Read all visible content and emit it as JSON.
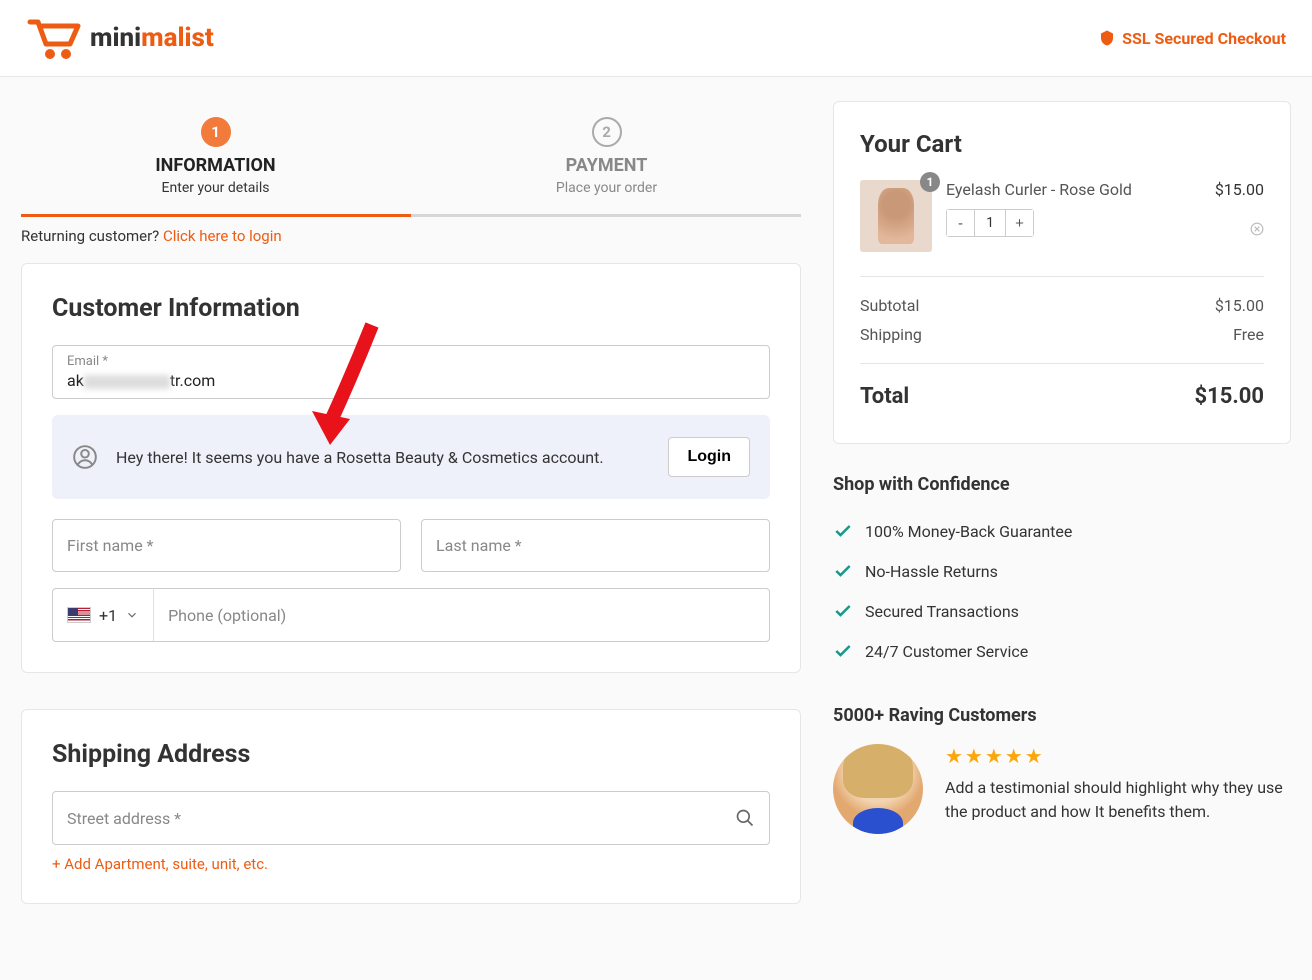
{
  "header": {
    "logo_part1": "mini",
    "logo_part2": "malist",
    "ssl_text": "SSL Secured Checkout"
  },
  "steps": {
    "step1_num": "1",
    "step1_title": "INFORMATION",
    "step1_sub": "Enter your details",
    "step2_num": "2",
    "step2_title": "PAYMENT",
    "step2_sub": "Place your order"
  },
  "returning": {
    "prefix": "Returning customer? ",
    "link": "Click here to login"
  },
  "customer": {
    "heading": "Customer Information",
    "email_label": "Email *",
    "email_prefix": "ak",
    "email_suffix": "tr.com",
    "notice": "Hey there! It seems you have a Rosetta Beauty & Cosmetics account.",
    "login_btn": "Login",
    "first_name_ph": "First name *",
    "last_name_ph": "Last name *",
    "dial": "+1",
    "phone_ph": "Phone (optional)"
  },
  "shipping": {
    "heading": "Shipping Address",
    "street_ph": "Street address *",
    "add_apt": "Add Apartment, suite, unit, etc."
  },
  "cart": {
    "heading": "Your Cart",
    "item_badge": "1",
    "item_name": "Eyelash Curler - Rose Gold",
    "item_price": "$15.00",
    "qty": "1",
    "subtotal_lbl": "Subtotal",
    "subtotal_val": "$15.00",
    "shipping_lbl": "Shipping",
    "shipping_val": "Free",
    "total_lbl": "Total",
    "total_val": "$15.00"
  },
  "confidence": {
    "heading": "Shop with Confidence",
    "i1": "100% Money-Back Guarantee",
    "i2": "No-Hassle Returns",
    "i3": "Secured Transactions",
    "i4": "24/7 Customer Service"
  },
  "raving": {
    "heading": "5000+ Raving Customers",
    "text": "Add a testimonial should highlight why they use the product and how It benefits them."
  }
}
